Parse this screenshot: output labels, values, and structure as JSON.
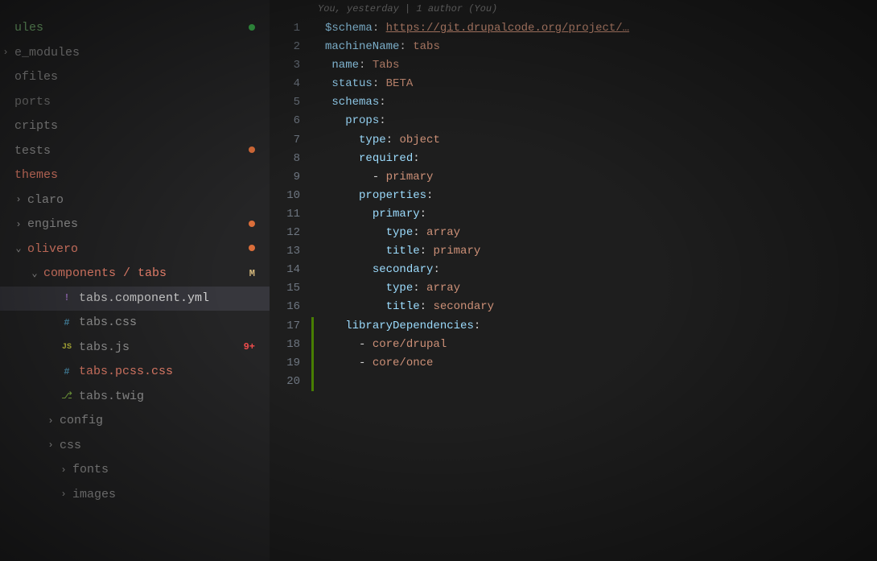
{
  "blame": "You, yesterday | 1 author (You)",
  "sidebar": {
    "items": [
      {
        "label": "ules",
        "indent": 0,
        "chevron": "",
        "icon": "",
        "cls": "highlight-green",
        "status_dot": "green"
      },
      {
        "label": "e_modules",
        "indent": 0,
        "chevron": ">",
        "icon": "",
        "cls": "muted"
      },
      {
        "label": "ofiles",
        "indent": 0,
        "chevron": "",
        "icon": "",
        "cls": "muted"
      },
      {
        "label": "ports",
        "indent": 0,
        "chevron": "",
        "icon": "",
        "cls": "dim"
      },
      {
        "label": "cripts",
        "indent": 0,
        "chevron": "",
        "icon": "",
        "cls": "muted"
      },
      {
        "label": "tests",
        "indent": 0,
        "chevron": "",
        "icon": "",
        "cls": "muted",
        "status_dot": "orange"
      },
      {
        "label": "themes",
        "indent": 0,
        "chevron": "",
        "icon": "",
        "cls": "highlight-red"
      },
      {
        "label": "claro",
        "indent": 1,
        "chevron": ">",
        "icon": "",
        "cls": "muted"
      },
      {
        "label": "engines",
        "indent": 1,
        "chevron": ">",
        "icon": "",
        "cls": "muted",
        "status_dot": "orange"
      },
      {
        "label": "olivero",
        "indent": 1,
        "chevron": "v",
        "icon": "",
        "cls": "highlight-red",
        "status_dot": "orange"
      },
      {
        "label": "components / tabs",
        "indent": 2,
        "chevron": "v",
        "icon": "",
        "cls": "highlight-red",
        "status_text": "M",
        "status_cls": "status-m"
      },
      {
        "label": "tabs.component.yml",
        "indent": 3,
        "chevron": "",
        "icon": "!",
        "icon_cls": "file-bang",
        "cls": "",
        "active": true
      },
      {
        "label": "tabs.css",
        "indent": 3,
        "chevron": "",
        "icon": "#",
        "icon_cls": "file-hash",
        "cls": "muted"
      },
      {
        "label": "tabs.js",
        "indent": 3,
        "chevron": "",
        "icon": "JS",
        "icon_cls": "file-js",
        "cls": "muted",
        "status_text": "9+",
        "status_cls": "status-9"
      },
      {
        "label": "tabs.pcss.css",
        "indent": 3,
        "chevron": "",
        "icon": "#",
        "icon_cls": "file-hash",
        "cls": "highlight-red"
      },
      {
        "label": "tabs.twig",
        "indent": 3,
        "chevron": "",
        "icon": "⎇",
        "icon_cls": "file-twig",
        "cls": "muted"
      },
      {
        "label": "config",
        "indent": 3,
        "chevron": ">",
        "icon": "",
        "cls": "muted"
      },
      {
        "label": "css",
        "indent": 3,
        "chevron": ">",
        "icon": "",
        "cls": "muted"
      },
      {
        "label": "fonts",
        "indent": 4,
        "chevron": ">",
        "icon": "",
        "cls": "muted"
      },
      {
        "label": "images",
        "indent": 4,
        "chevron": ">",
        "icon": "",
        "cls": "muted"
      }
    ]
  },
  "code": {
    "lines": [
      {
        "n": 1,
        "t": [
          [
            "tok-key",
            "$schema"
          ],
          [
            "tok-punct",
            ": "
          ],
          [
            "tok-url",
            "https://git.drupalcode.org/project/…"
          ]
        ]
      },
      {
        "n": 2,
        "t": [
          [
            "tok-key",
            "machineName"
          ],
          [
            "tok-punct",
            ": "
          ],
          [
            "tok-str",
            "tabs"
          ]
        ]
      },
      {
        "n": 3,
        "t": [
          [
            "tok-punct",
            " "
          ],
          [
            "tok-key",
            "name"
          ],
          [
            "tok-punct",
            ": "
          ],
          [
            "tok-str",
            "Tabs"
          ]
        ]
      },
      {
        "n": 4,
        "t": [
          [
            "tok-punct",
            " "
          ],
          [
            "tok-key",
            "status"
          ],
          [
            "tok-punct",
            ": "
          ],
          [
            "tok-str",
            "BETA"
          ]
        ]
      },
      {
        "n": 5,
        "t": [
          [
            "tok-punct",
            " "
          ],
          [
            "tok-key",
            "schemas"
          ],
          [
            "tok-punct",
            ":"
          ]
        ]
      },
      {
        "n": 6,
        "t": [
          [
            "tok-punct",
            "   "
          ],
          [
            "tok-key",
            "props"
          ],
          [
            "tok-punct",
            ":"
          ]
        ]
      },
      {
        "n": 7,
        "t": [
          [
            "tok-punct",
            "     "
          ],
          [
            "tok-key",
            "type"
          ],
          [
            "tok-punct",
            ": "
          ],
          [
            "tok-str",
            "object"
          ]
        ]
      },
      {
        "n": 8,
        "t": [
          [
            "tok-punct",
            "     "
          ],
          [
            "tok-key",
            "required"
          ],
          [
            "tok-punct",
            ":"
          ]
        ]
      },
      {
        "n": 9,
        "t": [
          [
            "tok-punct",
            "       - "
          ],
          [
            "tok-str",
            "primary"
          ]
        ]
      },
      {
        "n": 10,
        "t": [
          [
            "tok-punct",
            "     "
          ],
          [
            "tok-key",
            "properties"
          ],
          [
            "tok-punct",
            ":"
          ]
        ]
      },
      {
        "n": 11,
        "t": [
          [
            "tok-punct",
            "       "
          ],
          [
            "tok-key",
            "primary"
          ],
          [
            "tok-punct",
            ":"
          ]
        ]
      },
      {
        "n": 12,
        "t": [
          [
            "tok-punct",
            "         "
          ],
          [
            "tok-key",
            "type"
          ],
          [
            "tok-punct",
            ": "
          ],
          [
            "tok-str",
            "array"
          ]
        ]
      },
      {
        "n": 13,
        "t": [
          [
            "tok-punct",
            "         "
          ],
          [
            "tok-key",
            "title"
          ],
          [
            "tok-punct",
            ": "
          ],
          [
            "tok-str",
            "primary"
          ]
        ]
      },
      {
        "n": 14,
        "t": [
          [
            "tok-punct",
            "       "
          ],
          [
            "tok-key",
            "secondary"
          ],
          [
            "tok-punct",
            ":"
          ]
        ]
      },
      {
        "n": 15,
        "t": [
          [
            "tok-punct",
            "         "
          ],
          [
            "tok-key",
            "type"
          ],
          [
            "tok-punct",
            ": "
          ],
          [
            "tok-str",
            "array"
          ]
        ]
      },
      {
        "n": 16,
        "t": [
          [
            "tok-punct",
            "         "
          ],
          [
            "tok-key",
            "title"
          ],
          [
            "tok-punct",
            ": "
          ],
          [
            "tok-str",
            "secondary"
          ]
        ]
      },
      {
        "n": 17,
        "t": [
          [
            "tok-punct",
            "   "
          ],
          [
            "tok-key",
            "libraryDependencies"
          ],
          [
            "tok-punct",
            ":"
          ]
        ]
      },
      {
        "n": 18,
        "t": [
          [
            "tok-punct",
            "     - "
          ],
          [
            "tok-str",
            "core/drupal"
          ]
        ]
      },
      {
        "n": 19,
        "t": [
          [
            "tok-punct",
            "     - "
          ],
          [
            "tok-str",
            "core/once"
          ]
        ]
      },
      {
        "n": 20,
        "t": [
          [
            "tok-punct",
            ""
          ]
        ]
      }
    ],
    "git_added_range": {
      "start": 17,
      "end": 20
    }
  }
}
